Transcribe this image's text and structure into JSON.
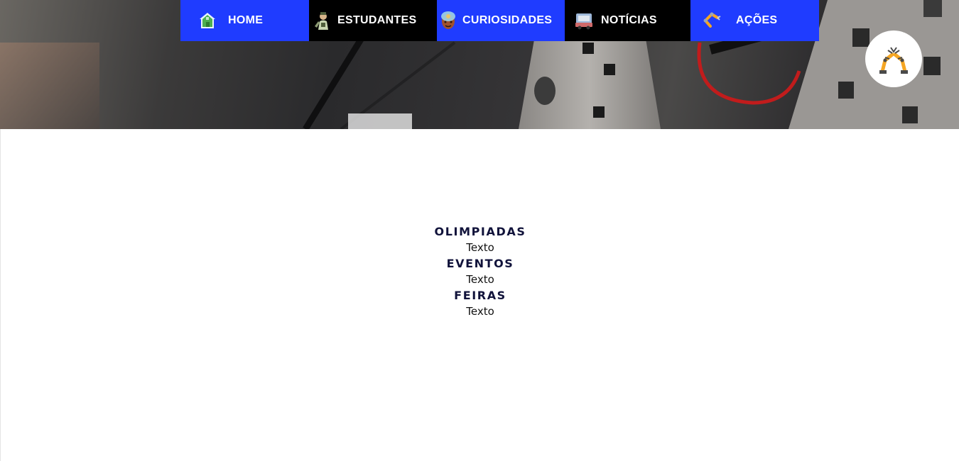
{
  "nav": {
    "items": [
      {
        "label": "HOME",
        "icon": "house-icon",
        "bg": "#1f3cff"
      },
      {
        "label": "ESTUDANTES",
        "icon": "student-icon",
        "bg": "#000000"
      },
      {
        "label": "CURIOSIDADES",
        "icon": "curious-face-icon",
        "bg": "#1f3cff"
      },
      {
        "label": "NOTÍCIAS",
        "icon": "newspaper-truck-icon",
        "bg": "#000000"
      },
      {
        "label": "AÇÕES",
        "icon": "robot-arm-icon",
        "bg": "#1f3cff"
      }
    ]
  },
  "logo": {
    "icon": "robotic-arms-logo-icon"
  },
  "sections": [
    {
      "title": "OLIMPIADAS",
      "text": "Texto"
    },
    {
      "title": "EVENTOS",
      "text": "Texto"
    },
    {
      "title": "FEIRAS",
      "text": "Texto"
    }
  ],
  "colors": {
    "nav_blue": "#1f3cff",
    "nav_black": "#000000",
    "title_navy": "#10123a"
  }
}
